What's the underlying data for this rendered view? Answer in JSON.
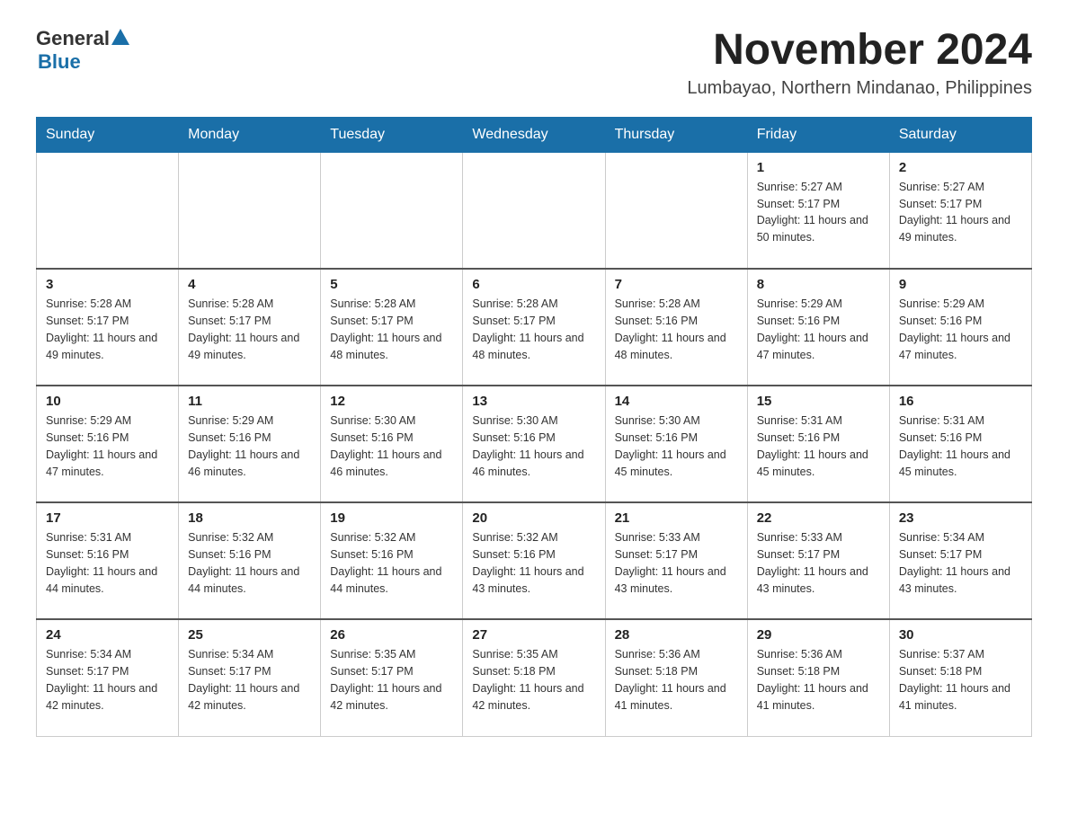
{
  "header": {
    "logo_general": "General",
    "logo_blue": "Blue",
    "month_title": "November 2024",
    "subtitle": "Lumbayao, Northern Mindanao, Philippines"
  },
  "days_of_week": [
    "Sunday",
    "Monday",
    "Tuesday",
    "Wednesday",
    "Thursday",
    "Friday",
    "Saturday"
  ],
  "weeks": [
    [
      {
        "day": "",
        "info": ""
      },
      {
        "day": "",
        "info": ""
      },
      {
        "day": "",
        "info": ""
      },
      {
        "day": "",
        "info": ""
      },
      {
        "day": "",
        "info": ""
      },
      {
        "day": "1",
        "info": "Sunrise: 5:27 AM\nSunset: 5:17 PM\nDaylight: 11 hours and 50 minutes."
      },
      {
        "day": "2",
        "info": "Sunrise: 5:27 AM\nSunset: 5:17 PM\nDaylight: 11 hours and 49 minutes."
      }
    ],
    [
      {
        "day": "3",
        "info": "Sunrise: 5:28 AM\nSunset: 5:17 PM\nDaylight: 11 hours and 49 minutes."
      },
      {
        "day": "4",
        "info": "Sunrise: 5:28 AM\nSunset: 5:17 PM\nDaylight: 11 hours and 49 minutes."
      },
      {
        "day": "5",
        "info": "Sunrise: 5:28 AM\nSunset: 5:17 PM\nDaylight: 11 hours and 48 minutes."
      },
      {
        "day": "6",
        "info": "Sunrise: 5:28 AM\nSunset: 5:17 PM\nDaylight: 11 hours and 48 minutes."
      },
      {
        "day": "7",
        "info": "Sunrise: 5:28 AM\nSunset: 5:16 PM\nDaylight: 11 hours and 48 minutes."
      },
      {
        "day": "8",
        "info": "Sunrise: 5:29 AM\nSunset: 5:16 PM\nDaylight: 11 hours and 47 minutes."
      },
      {
        "day": "9",
        "info": "Sunrise: 5:29 AM\nSunset: 5:16 PM\nDaylight: 11 hours and 47 minutes."
      }
    ],
    [
      {
        "day": "10",
        "info": "Sunrise: 5:29 AM\nSunset: 5:16 PM\nDaylight: 11 hours and 47 minutes."
      },
      {
        "day": "11",
        "info": "Sunrise: 5:29 AM\nSunset: 5:16 PM\nDaylight: 11 hours and 46 minutes."
      },
      {
        "day": "12",
        "info": "Sunrise: 5:30 AM\nSunset: 5:16 PM\nDaylight: 11 hours and 46 minutes."
      },
      {
        "day": "13",
        "info": "Sunrise: 5:30 AM\nSunset: 5:16 PM\nDaylight: 11 hours and 46 minutes."
      },
      {
        "day": "14",
        "info": "Sunrise: 5:30 AM\nSunset: 5:16 PM\nDaylight: 11 hours and 45 minutes."
      },
      {
        "day": "15",
        "info": "Sunrise: 5:31 AM\nSunset: 5:16 PM\nDaylight: 11 hours and 45 minutes."
      },
      {
        "day": "16",
        "info": "Sunrise: 5:31 AM\nSunset: 5:16 PM\nDaylight: 11 hours and 45 minutes."
      }
    ],
    [
      {
        "day": "17",
        "info": "Sunrise: 5:31 AM\nSunset: 5:16 PM\nDaylight: 11 hours and 44 minutes."
      },
      {
        "day": "18",
        "info": "Sunrise: 5:32 AM\nSunset: 5:16 PM\nDaylight: 11 hours and 44 minutes."
      },
      {
        "day": "19",
        "info": "Sunrise: 5:32 AM\nSunset: 5:16 PM\nDaylight: 11 hours and 44 minutes."
      },
      {
        "day": "20",
        "info": "Sunrise: 5:32 AM\nSunset: 5:16 PM\nDaylight: 11 hours and 43 minutes."
      },
      {
        "day": "21",
        "info": "Sunrise: 5:33 AM\nSunset: 5:17 PM\nDaylight: 11 hours and 43 minutes."
      },
      {
        "day": "22",
        "info": "Sunrise: 5:33 AM\nSunset: 5:17 PM\nDaylight: 11 hours and 43 minutes."
      },
      {
        "day": "23",
        "info": "Sunrise: 5:34 AM\nSunset: 5:17 PM\nDaylight: 11 hours and 43 minutes."
      }
    ],
    [
      {
        "day": "24",
        "info": "Sunrise: 5:34 AM\nSunset: 5:17 PM\nDaylight: 11 hours and 42 minutes."
      },
      {
        "day": "25",
        "info": "Sunrise: 5:34 AM\nSunset: 5:17 PM\nDaylight: 11 hours and 42 minutes."
      },
      {
        "day": "26",
        "info": "Sunrise: 5:35 AM\nSunset: 5:17 PM\nDaylight: 11 hours and 42 minutes."
      },
      {
        "day": "27",
        "info": "Sunrise: 5:35 AM\nSunset: 5:18 PM\nDaylight: 11 hours and 42 minutes."
      },
      {
        "day": "28",
        "info": "Sunrise: 5:36 AM\nSunset: 5:18 PM\nDaylight: 11 hours and 41 minutes."
      },
      {
        "day": "29",
        "info": "Sunrise: 5:36 AM\nSunset: 5:18 PM\nDaylight: 11 hours and 41 minutes."
      },
      {
        "day": "30",
        "info": "Sunrise: 5:37 AM\nSunset: 5:18 PM\nDaylight: 11 hours and 41 minutes."
      }
    ]
  ],
  "colors": {
    "header_bg": "#1a6fa8",
    "border": "#aaaaaa",
    "row_separator": "#555555"
  }
}
